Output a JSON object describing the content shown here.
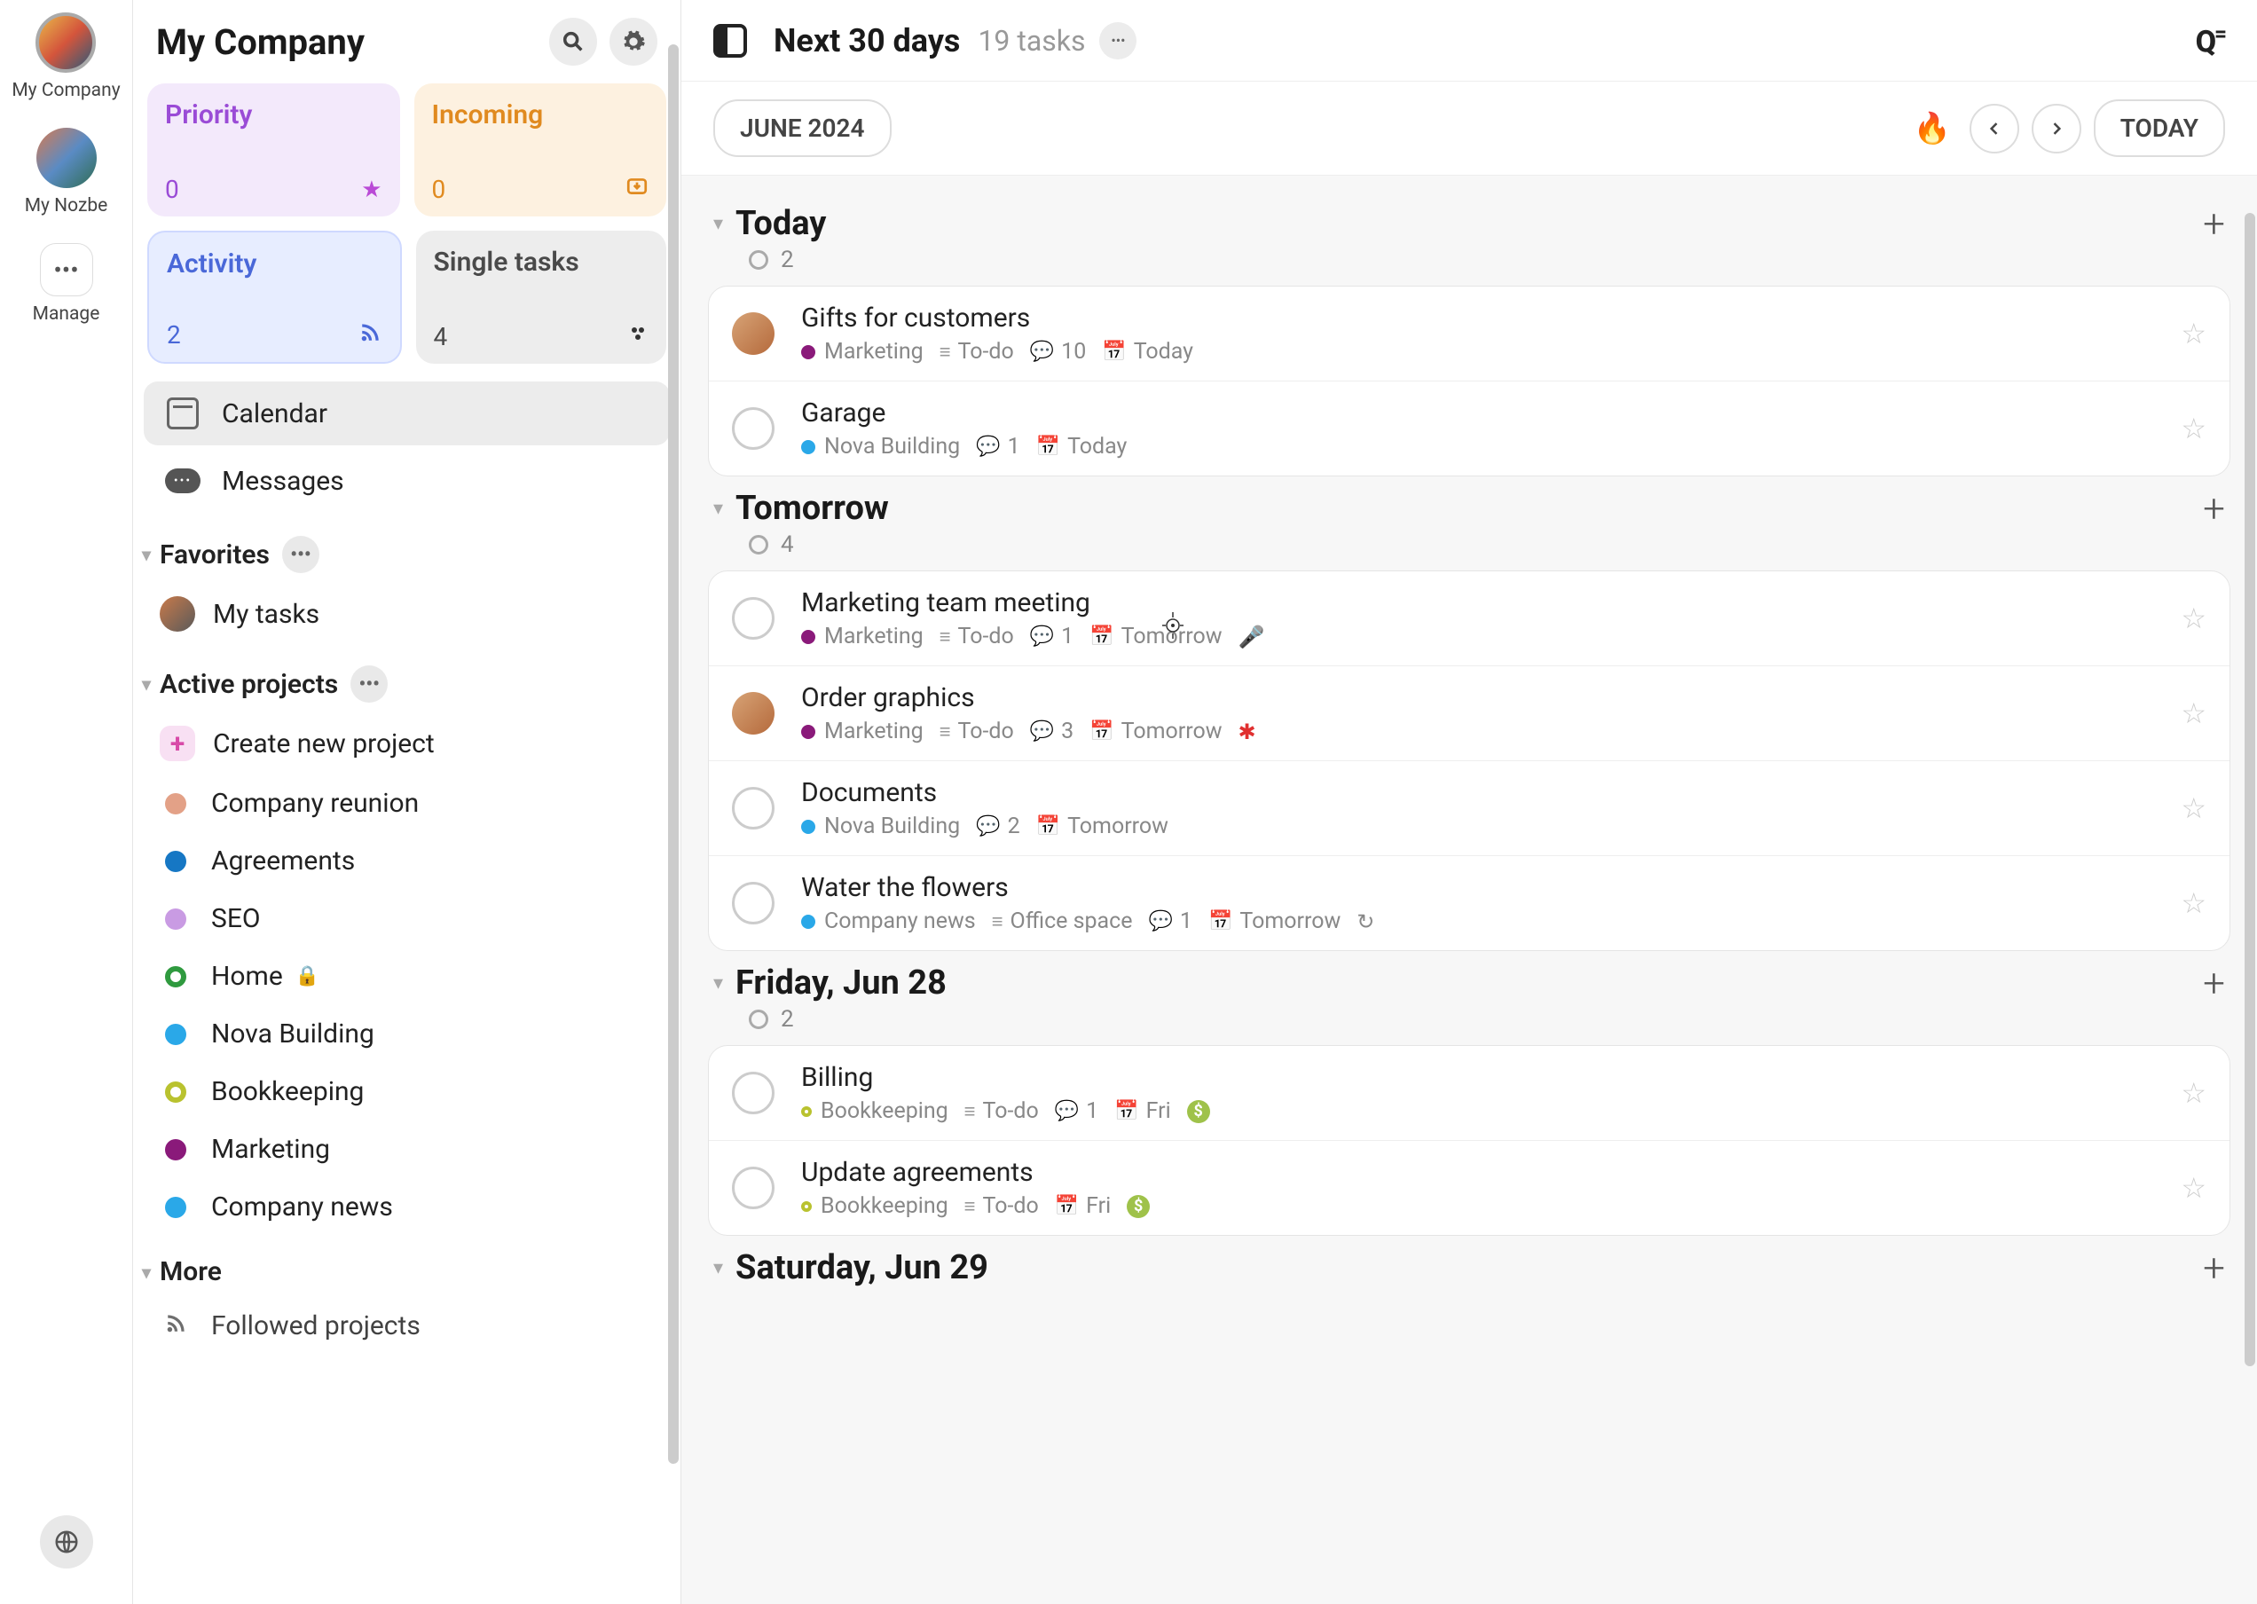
{
  "rail": {
    "items": [
      {
        "label": "My Company",
        "active": true
      },
      {
        "label": "My Nozbe"
      },
      {
        "label": "Manage"
      }
    ]
  },
  "sidebar": {
    "title": "My Company",
    "tiles": {
      "priority": {
        "title": "Priority",
        "count": "0"
      },
      "incoming": {
        "title": "Incoming",
        "count": "0"
      },
      "activity": {
        "title": "Activity",
        "count": "2"
      },
      "single": {
        "title": "Single tasks",
        "count": "4"
      }
    },
    "nav": {
      "calendar": "Calendar",
      "messages": "Messages"
    },
    "favorites": {
      "title": "Favorites",
      "items": [
        {
          "label": "My tasks"
        }
      ]
    },
    "active": {
      "title": "Active projects",
      "create": "Create new project",
      "items": [
        {
          "label": "Company reunion",
          "color": "#e3a187"
        },
        {
          "label": "Agreements",
          "color": "#1677c4"
        },
        {
          "label": "SEO",
          "color": "#c99be3"
        },
        {
          "label": "Home",
          "color": "#2f9a3f",
          "ring": true,
          "locked": true
        },
        {
          "label": "Nova Building",
          "color": "#2aa8e8"
        },
        {
          "label": "Bookkeeping",
          "color": "#b9c22f",
          "ring": true
        },
        {
          "label": "Marketing",
          "color": "#8a1a7a"
        },
        {
          "label": "Company news",
          "color": "#2aa8e8"
        }
      ]
    },
    "more": {
      "title": "More",
      "followed": "Followed projects"
    }
  },
  "main": {
    "title": "Next 30 days",
    "task_count": "19 tasks",
    "month_label": "JUNE 2024",
    "today_label": "TODAY",
    "sections": [
      {
        "title": "Today",
        "count": "2",
        "tasks": [
          {
            "title": "Gifts for customers",
            "avatar": true,
            "project": "Marketing",
            "projectColor": "#8a1a7a",
            "list": "To-do",
            "comments": "10",
            "date": "Today"
          },
          {
            "title": "Garage",
            "project": "Nova Building",
            "projectColor": "#2aa8e8",
            "comments": "1",
            "date": "Today"
          }
        ]
      },
      {
        "title": "Tomorrow",
        "count": "4",
        "tasks": [
          {
            "title": "Marketing team meeting",
            "project": "Marketing",
            "projectColor": "#8a1a7a",
            "list": "To-do",
            "comments": "1",
            "date": "Tomorrow",
            "extra": "mic"
          },
          {
            "title": "Order graphics",
            "avatar": true,
            "project": "Marketing",
            "projectColor": "#8a1a7a",
            "list": "To-do",
            "comments": "3",
            "date": "Tomorrow",
            "extra": "splat"
          },
          {
            "title": "Documents",
            "project": "Nova Building",
            "projectColor": "#2aa8e8",
            "comments": "2",
            "date": "Tomorrow"
          },
          {
            "title": "Water the flowers",
            "project": "Company news",
            "projectColor": "#2aa8e8",
            "list": "Office space",
            "comments": "1",
            "date": "Tomorrow",
            "extra": "repeat"
          }
        ]
      },
      {
        "title": "Friday, Jun 28",
        "count": "2",
        "tasks": [
          {
            "title": "Billing",
            "project": "Bookkeeping",
            "projectColor": "#b9c22f",
            "ring": true,
            "list": "To-do",
            "comments": "1",
            "date": "Fri",
            "extra": "dollar"
          },
          {
            "title": "Update agreements",
            "project": "Bookkeeping",
            "projectColor": "#b9c22f",
            "ring": true,
            "list": "To-do",
            "date": "Fri",
            "extra": "dollar"
          }
        ]
      },
      {
        "title": "Saturday, Jun 29",
        "count": "",
        "tasks": []
      }
    ]
  }
}
